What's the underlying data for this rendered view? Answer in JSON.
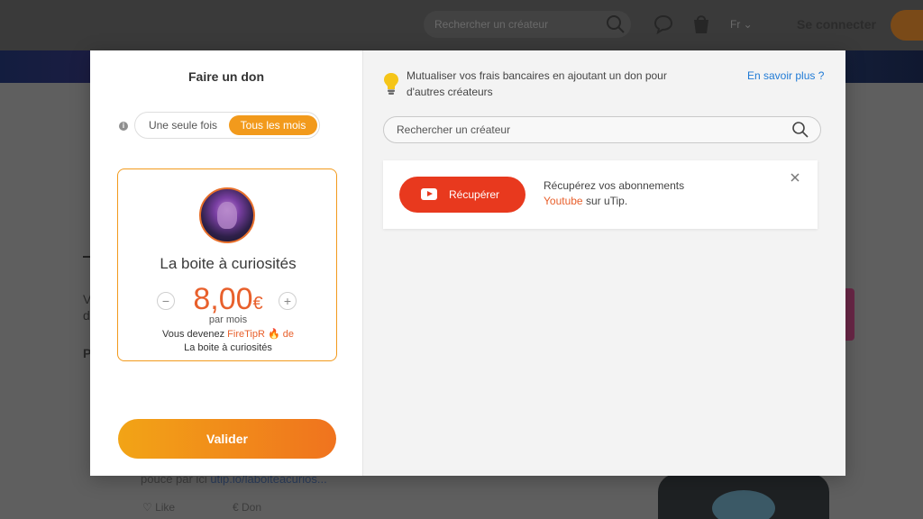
{
  "background": {
    "search_placeholder": "Rechercher un créateur",
    "language": "Fr ⌄",
    "login": "Se connecter",
    "post_text": "pouce par ici ",
    "post_link": "utip.io/laboiteacurios...",
    "like": "Like",
    "don": "Don"
  },
  "modal": {
    "title": "Faire un don",
    "frequency": {
      "once_label": "Une seule fois",
      "monthly_label": "Tous les mois",
      "selected": "Tous les mois"
    },
    "card": {
      "creator_name": "La boite à curiosités",
      "amount": "8,00",
      "currency": "€",
      "per_month": "par mois",
      "become_prefix": "Vous devenez ",
      "become_highlight": "FireTipR",
      "become_emoji": "🔥",
      "become_de": " de",
      "become_name": "La boite à curiosités"
    },
    "validate_label": "Valider",
    "right": {
      "mutual_text": "Mutualiser vos frais bancaires en ajoutant un don pour d'autres créateurs",
      "learn_more": "En savoir plus ?",
      "search_placeholder": "Rechercher un créateur",
      "yt_button_label": "Récupérer",
      "yt_line1": "Récupérez vos abonnements",
      "yt_word": "Youtube",
      "yt_line2_suffix": " sur uTip."
    }
  },
  "colors": {
    "accent_orange": "#f29a1c",
    "amount_orange": "#e8602c",
    "youtube_red": "#e8391e",
    "link_blue": "#1f7ad6"
  }
}
